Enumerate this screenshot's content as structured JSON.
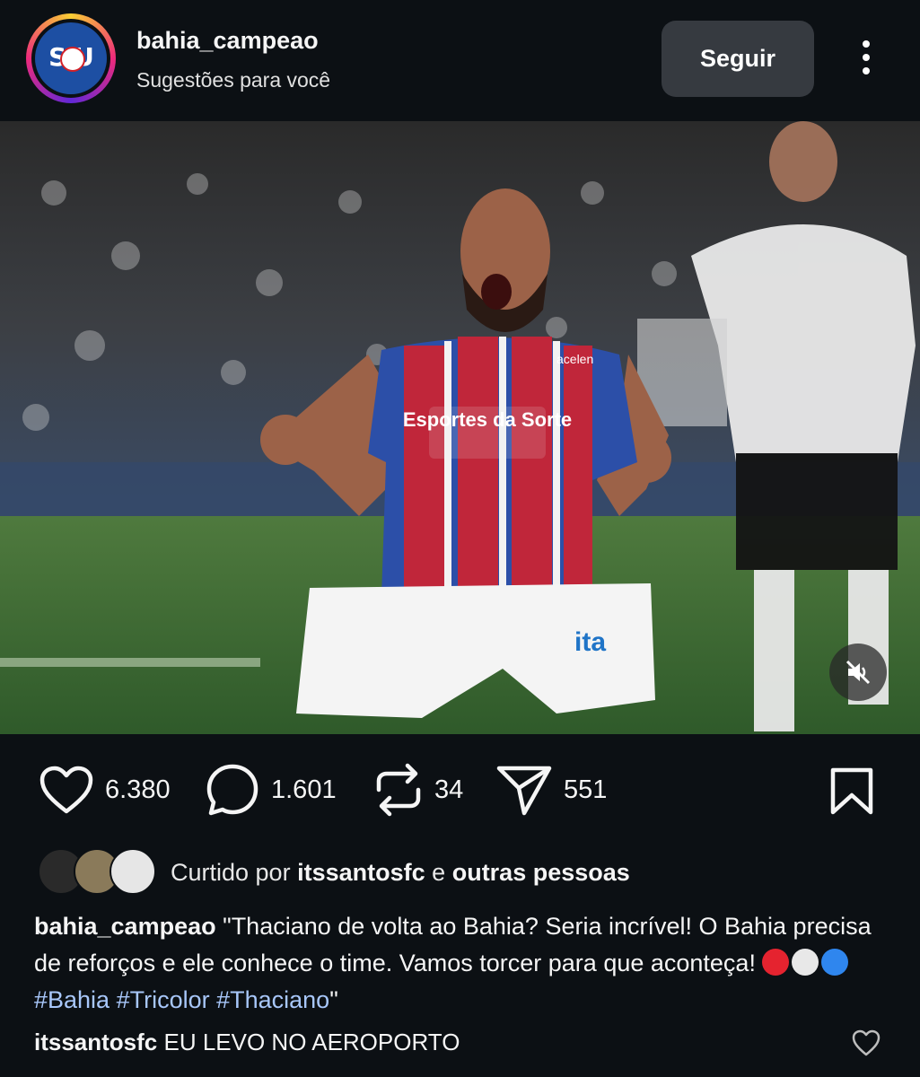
{
  "post": {
    "username": "bahia_campeao",
    "subtitle": "Sugestões para você",
    "avatar_text": "S U",
    "follow_label": "Seguir"
  },
  "media": {
    "jersey_sponsor": "Esportes da Sorte",
    "kit_brand": "acelen",
    "shorts_sponsor": "ita",
    "muted": true
  },
  "actions": {
    "likes": "6.380",
    "comments": "1.601",
    "reposts": "34",
    "shares": "551"
  },
  "liked_by": {
    "prefix": "Curtido por",
    "user": "itssantosfc",
    "connector": "e",
    "rest": "outras pessoas"
  },
  "caption": {
    "user": "bahia_campeao",
    "text": "\"Thaciano de volta ao Bahia? Seria incrível! O Bahia precisa de reforços e ele conhece o time. Vamos torcer para que aconteça!",
    "hashtags": "#Bahia #Tricolor #Thaciano",
    "closing": "\""
  },
  "comment": {
    "user": "itssantosfc",
    "text": "EU LEVO NO AEROPORTO"
  },
  "colors": {
    "background": "#0c1014",
    "follow_button": "#363a40",
    "hashtag": "#a8c7fa",
    "dot_red": "#e5232f",
    "dot_white": "#e8e8e8",
    "dot_blue": "#2f86ee"
  }
}
